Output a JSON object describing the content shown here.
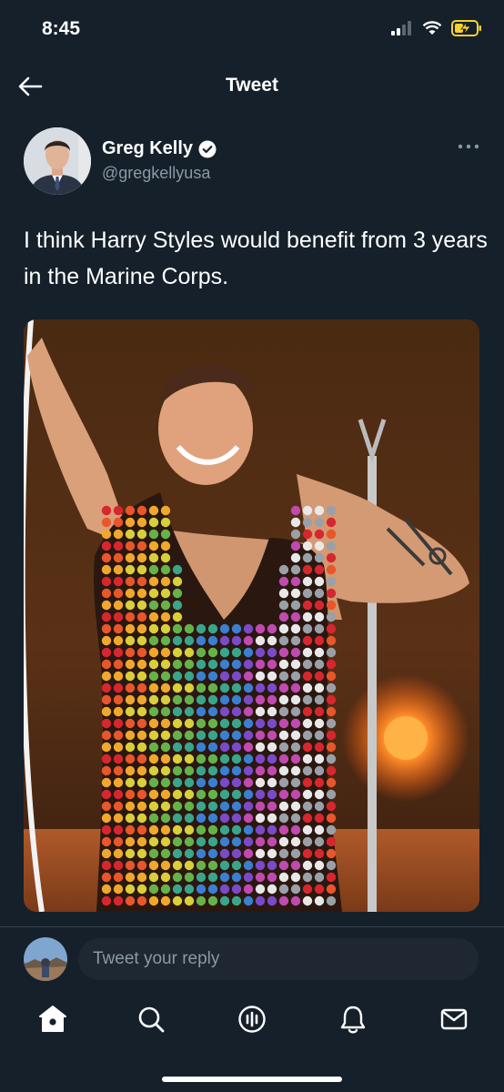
{
  "status_bar": {
    "time": "8:45"
  },
  "header": {
    "title": "Tweet"
  },
  "author": {
    "name": "Greg Kelly",
    "handle": "@gregkellyusa"
  },
  "tweet": {
    "text": "I think Harry Styles would benefit from 3 years in the Marine Corps."
  },
  "reply": {
    "placeholder": "Tweet your reply"
  },
  "tabs": [
    "home-icon",
    "search-icon",
    "spaces-icon",
    "notifications-icon",
    "messages-icon"
  ],
  "colors": {
    "background": "#15202b",
    "accent": "#1d9bf0",
    "muted": "#8b98a5",
    "battery": "#f5d130"
  }
}
